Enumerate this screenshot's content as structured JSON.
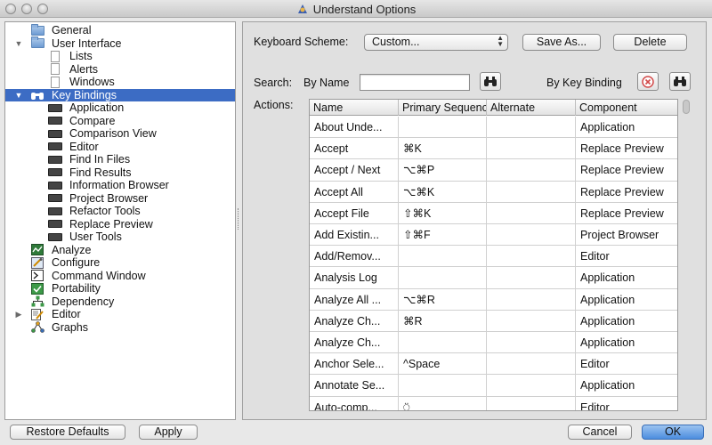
{
  "window": {
    "title": "Understand Options"
  },
  "sidebar": {
    "items": [
      {
        "label": "General",
        "icon": "folder-icon",
        "level": 0,
        "arrow": ""
      },
      {
        "label": "User Interface",
        "icon": "folder-icon",
        "level": 0,
        "arrow": "▼"
      },
      {
        "label": "Lists",
        "icon": "page-icon",
        "level": 1,
        "arrow": ""
      },
      {
        "label": "Alerts",
        "icon": "page-icon",
        "level": 1,
        "arrow": ""
      },
      {
        "label": "Windows",
        "icon": "page-icon",
        "level": 1,
        "arrow": ""
      },
      {
        "label": "Key Bindings",
        "icon": "binoculars-icon",
        "level": 0,
        "arrow": "▼",
        "selected": true
      },
      {
        "label": "Application",
        "icon": "keyboard-icon",
        "level": 1,
        "arrow": ""
      },
      {
        "label": "Compare",
        "icon": "keyboard-icon",
        "level": 1,
        "arrow": ""
      },
      {
        "label": "Comparison View",
        "icon": "keyboard-icon",
        "level": 1,
        "arrow": ""
      },
      {
        "label": "Editor",
        "icon": "keyboard-icon",
        "level": 1,
        "arrow": ""
      },
      {
        "label": "Find In Files",
        "icon": "keyboard-icon",
        "level": 1,
        "arrow": ""
      },
      {
        "label": "Find Results",
        "icon": "keyboard-icon",
        "level": 1,
        "arrow": ""
      },
      {
        "label": "Information Browser",
        "icon": "keyboard-icon",
        "level": 1,
        "arrow": ""
      },
      {
        "label": "Project Browser",
        "icon": "keyboard-icon",
        "level": 1,
        "arrow": ""
      },
      {
        "label": "Refactor Tools",
        "icon": "keyboard-icon",
        "level": 1,
        "arrow": ""
      },
      {
        "label": "Replace Preview",
        "icon": "keyboard-icon",
        "level": 1,
        "arrow": ""
      },
      {
        "label": "User Tools",
        "icon": "keyboard-icon",
        "level": 1,
        "arrow": ""
      },
      {
        "label": "Analyze",
        "icon": "analyze-icon",
        "level": 0,
        "arrow": ""
      },
      {
        "label": "Configure",
        "icon": "configure-icon",
        "level": 0,
        "arrow": ""
      },
      {
        "label": "Command Window",
        "icon": "terminal-icon",
        "level": 0,
        "arrow": ""
      },
      {
        "label": "Portability",
        "icon": "portability-icon",
        "level": 0,
        "arrow": ""
      },
      {
        "label": "Dependency",
        "icon": "dependency-icon",
        "level": 0,
        "arrow": ""
      },
      {
        "label": "Editor",
        "icon": "editor-icon",
        "level": 0,
        "arrow": "▶"
      },
      {
        "label": "Graphs",
        "icon": "graphs-icon",
        "level": 0,
        "arrow": ""
      }
    ]
  },
  "keyboard_scheme": {
    "label": "Keyboard Scheme:",
    "value": "Custom...",
    "save_as": "Save As...",
    "delete": "Delete"
  },
  "search": {
    "label": "Search:",
    "by_name_label": "By Name",
    "by_name_value": "",
    "by_key_label": "By Key Binding"
  },
  "actions": {
    "label": "Actions:",
    "columns": [
      "Name",
      "Primary Sequence",
      "Alternate",
      "Component"
    ],
    "rows": [
      [
        "About Unde...",
        "",
        "",
        "Application"
      ],
      [
        "Accept",
        "⌘K",
        "",
        "Replace Preview"
      ],
      [
        "Accept / Next",
        "⌥⌘P",
        "",
        "Replace Preview"
      ],
      [
        "Accept All",
        "⌥⌘K",
        "",
        "Replace Preview"
      ],
      [
        "Accept File",
        "⇧⌘K",
        "",
        "Replace Preview"
      ],
      [
        "Add Existin...",
        "⇧⌘F",
        "",
        "Project Browser"
      ],
      [
        "Add/Remov...",
        "",
        "",
        "Editor"
      ],
      [
        "Analysis Log",
        "",
        "",
        "Application"
      ],
      [
        "Analyze All ...",
        "⌥⌘R",
        "",
        "Application"
      ],
      [
        "Analyze Ch...",
        "⌘R",
        "",
        "Application"
      ],
      [
        "Analyze Ch...",
        "",
        "",
        "Application"
      ],
      [
        "Anchor Sele...",
        "^Space",
        "",
        "Editor"
      ],
      [
        "Annotate Se...",
        "",
        "",
        "Application"
      ],
      [
        "Auto-comp...",
        "⍥",
        "",
        "Editor"
      ]
    ]
  },
  "footer": {
    "restore_defaults": "Restore Defaults",
    "apply": "Apply",
    "cancel": "Cancel",
    "ok": "OK"
  },
  "colors": {
    "selection": "#3c6cc4",
    "default_button": "#4c8ddf"
  }
}
